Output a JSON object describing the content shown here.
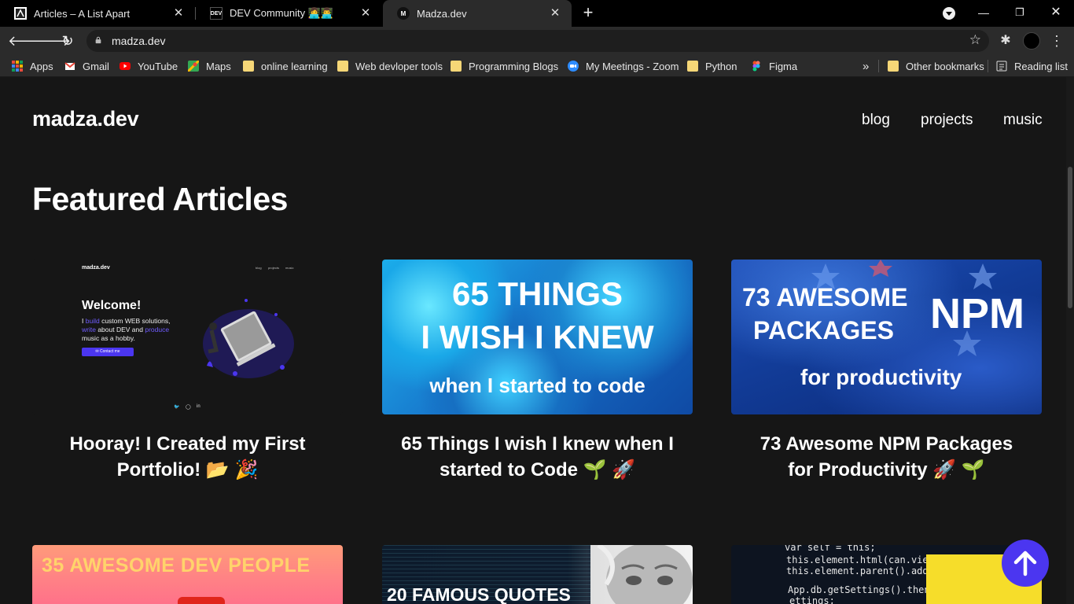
{
  "browser": {
    "tabs": [
      {
        "title": "Articles – A List Apart",
        "favicon": "ala-icon"
      },
      {
        "title": "DEV Community 👩‍💻👨‍💻",
        "favicon": "dev-icon",
        "favicon_text": "DEV"
      },
      {
        "title": "Madza.dev",
        "favicon": "madza-icon",
        "favicon_text": "M",
        "active": true
      }
    ],
    "url": "madza.dev",
    "bookmarks": [
      {
        "label": "Apps"
      },
      {
        "label": "Gmail"
      },
      {
        "label": "YouTube"
      },
      {
        "label": "Maps"
      },
      {
        "label": "online learning"
      },
      {
        "label": "Web devloper tools"
      },
      {
        "label": "Programming Blogs"
      },
      {
        "label": "My Meetings - Zoom"
      },
      {
        "label": "Python"
      },
      {
        "label": "Figma"
      }
    ],
    "bookmarks_overflow": "»",
    "other_bookmarks": "Other bookmarks",
    "reading_list": "Reading list"
  },
  "site": {
    "logo": "madza.dev",
    "nav": [
      "blog",
      "projects",
      "music"
    ],
    "section_title": "Featured Articles",
    "articles": [
      {
        "title_line1": "Hooray! I Created my First",
        "title_line2": "Portfolio! 📂 🎉",
        "thumb": {
          "logo": "madza.dev",
          "nav": [
            "blog",
            "projects",
            "music"
          ],
          "heading": "Welcome!",
          "desc_1": "I ",
          "desc_build": "build",
          "desc_2": " custom WEB solutions,",
          "desc_write": "write",
          "desc_3": " about DEV and ",
          "desc_produce": "produce",
          "desc_4": " music as a hobby.",
          "button": "✉ Contact me",
          "social": [
            "🐦",
            "◯",
            "in"
          ]
        }
      },
      {
        "title_line1": "65 Things I wish I knew when I",
        "title_line2": "started to Code 🌱 🚀",
        "thumb": {
          "line1": "65 THINGS",
          "line2": "I WISH I KNEW",
          "line3": "when I started to code"
        }
      },
      {
        "title_line1": "73 Awesome NPM Packages",
        "title_line2": "for Productivity 🚀 🌱",
        "thumb": {
          "line1": "73 AWESOME",
          "line2": "PACKAGES",
          "line3": "for productivity",
          "badge": "NPM"
        }
      },
      {
        "thumb": {
          "line1": "35 AWESOME DEV PEOPLE"
        }
      },
      {
        "thumb": {
          "line1": "20 FAMOUS QUOTES"
        }
      },
      {
        "thumb": {
          "code": [
            "var self = this;",
            "this.element.html(can.view('//app/src/vi",
            "this.element.parent().add",
            "App.db.getSettings().then",
            "                  ettings;"
          ]
        }
      }
    ]
  },
  "colors": {
    "accent": "#4b36f0",
    "page_bg": "#161616"
  }
}
